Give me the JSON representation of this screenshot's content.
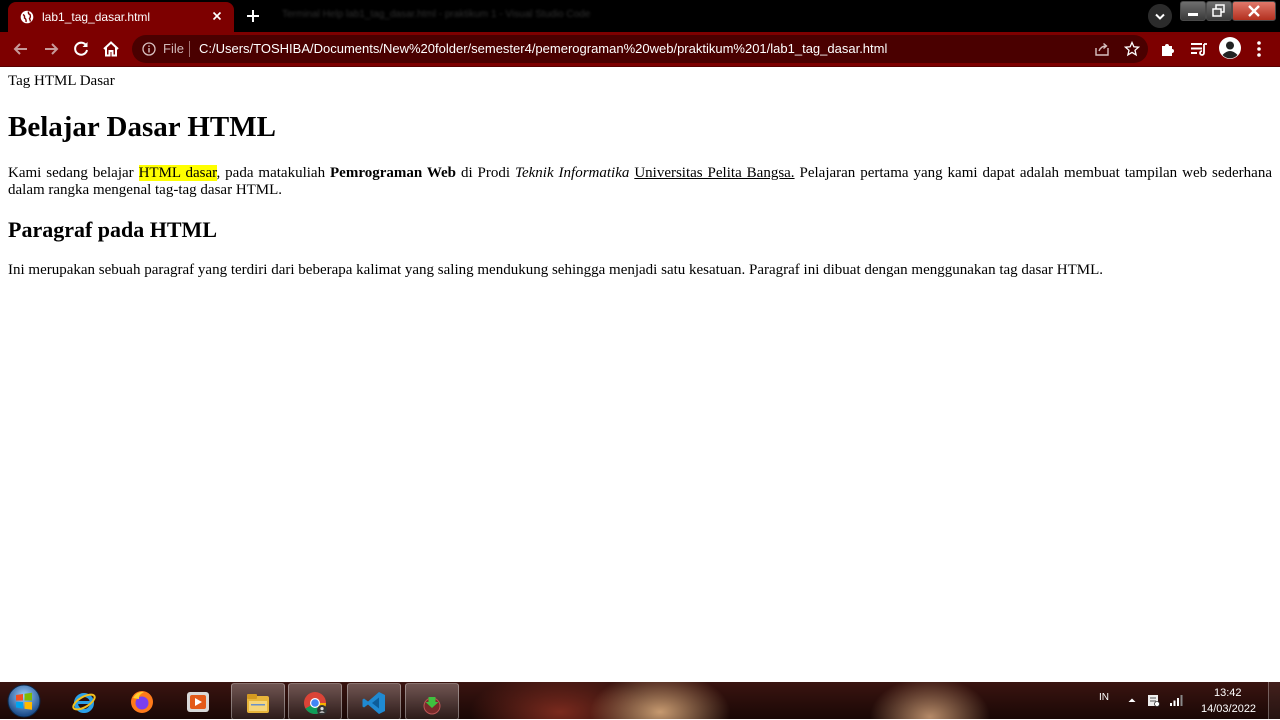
{
  "browser": {
    "tab": {
      "title": "lab1_tag_dasar.html"
    },
    "background_window_title": "Terminal   Help                                                         lab1_tag_dasar.html - praktikum 1 - Visual Studio Code",
    "address_bar": {
      "scheme_label": "File",
      "url": "C:/Users/TOSHIBA/Documents/New%20folder/semester4/pemerograman%20web/praktikum%201/lab1_tag_dasar.html"
    },
    "accent_color": "#7d0000"
  },
  "page": {
    "document_title": "Tag HTML Dasar",
    "heading": "Belajar Dasar HTML",
    "paragraph1": {
      "t1": "Kami sedang belajar ",
      "highlight": "HTML dasar",
      "t2": ", pada matakuliah ",
      "bold": "Pemrograman Web",
      "t3": " di Prodi ",
      "italic": "Teknik Informatika",
      "t4": " ",
      "underline": "Universitas Pelita Bangsa.",
      "t5": " Pelajaran pertama yang kami dapat adalah membuat tampilan web sederhana dalam rangka mengenal tag-tag dasar HTML."
    },
    "subheading": "Paragraf pada HTML",
    "paragraph2": "Ini merupakan sebuah paragraf yang terdiri dari beberapa kalimat yang saling mendukung sehingga menjadi satu kesatuan. Paragraf ini dibuat dengan menggunakan tag dasar HTML."
  },
  "taskbar": {
    "apps": [
      "start-orb",
      "internet-explorer-icon",
      "firefox-icon",
      "media-player-icon",
      "file-explorer-icon",
      "chrome-icon",
      "vscode-icon",
      "download-manager-icon"
    ],
    "tray": {
      "language": "IN",
      "time": "13:42",
      "date": "14/03/2022"
    }
  }
}
